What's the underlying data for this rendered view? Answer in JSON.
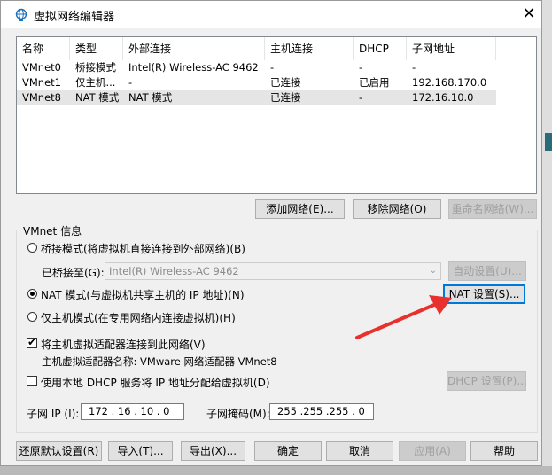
{
  "window": {
    "title": "虚拟网络编辑器",
    "close_glyph": "✕"
  },
  "table": {
    "columns": [
      "名称",
      "类型",
      "外部连接",
      "主机连接",
      "DHCP",
      "子网地址"
    ],
    "rows": [
      [
        "VMnet0",
        "桥接模式",
        "Intel(R) Wireless-AC 9462",
        "-",
        "-",
        "-"
      ],
      [
        "VMnet1",
        "仅主机...",
        "-",
        "已连接",
        "已启用",
        "192.168.170.0"
      ],
      [
        "VMnet8",
        "NAT 模式",
        "NAT 模式",
        "已连接",
        "-",
        "172.16.10.0"
      ]
    ],
    "selected_row": 2
  },
  "list_buttons": {
    "add": "添加网络(E)...",
    "remove": "移除网络(O)",
    "rename": "重命名网络(W)..."
  },
  "vmnet_info": {
    "group_label": "VMnet 信息",
    "bridge_radio": "桥接模式(将虚拟机直接连接到外部网络)(B)",
    "bridged_to_label": "已桥接至(G):",
    "bridged_to_value": "Intel(R) Wireless-AC 9462",
    "auto_settings": "自动设置(U)...",
    "nat_radio": "NAT 模式(与虚拟机共享主机的 IP 地址)(N)",
    "nat_settings": "NAT 设置(S)...",
    "hostonly_radio": "仅主机模式(在专用网络内连接虚拟机)(H)",
    "connect_adapter_check": "将主机虚拟适配器连接到此网络(V)",
    "adapter_name": "主机虚拟适配器名称: VMware 网络适配器 VMnet8",
    "dhcp_check": "使用本地 DHCP 服务将 IP 地址分配给虚拟机(D)",
    "dhcp_settings": "DHCP 设置(P)...",
    "subnet_ip_label": "子网 IP (I):",
    "subnet_ip": "172 . 16 . 10 . 0",
    "subnet_mask_label": "子网掩码(M):",
    "subnet_mask": "255 .255 .255 . 0",
    "selected_mode": "nat",
    "connect_adapter_checked": true,
    "dhcp_checked": false
  },
  "footer": {
    "restore": "还原默认设置(R)",
    "import": "导入(T)...",
    "export": "导出(X)...",
    "ok": "确定",
    "cancel": "取消",
    "apply": "应用(A)",
    "help": "帮助"
  },
  "colors": {
    "annotation_arrow": "#e8302c",
    "focus_border": "#0078d7",
    "selected_row": "#e5e5e5"
  },
  "icons": {
    "app": "globe-network-icon",
    "close": "close-icon",
    "dropdown": "chevron-down-icon"
  }
}
